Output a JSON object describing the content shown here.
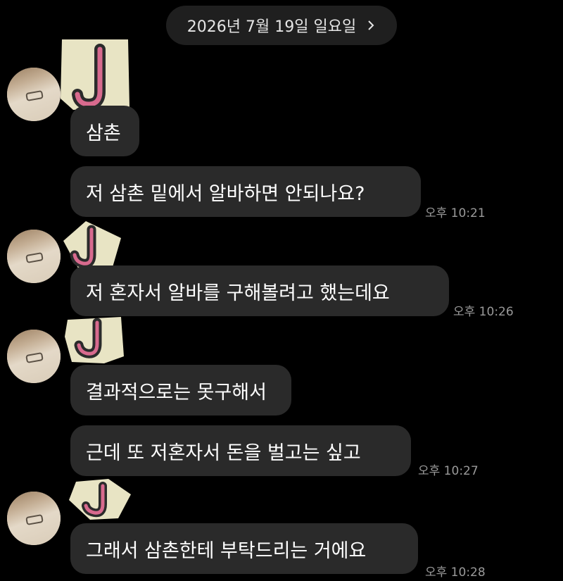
{
  "header": {
    "date_label": "2026년 7월 19일 일요일"
  },
  "messages": [
    {
      "text": "삼촌",
      "time": ""
    },
    {
      "text": "저 삼촌 밑에서 알바하면 안되나요?",
      "time": "오후 10:21"
    },
    {
      "text": "저 혼자서 알바를 구해볼려고 했는데요",
      "time": "오후 10:26"
    },
    {
      "text": "결과적으로는 못구해서",
      "time": ""
    },
    {
      "text": "근데 또 저혼자서 돈을 벌고는 싶고",
      "time": "오후 10:27"
    },
    {
      "text": "그래서 삼촌한테 부탁드리는 거에요",
      "time": "오후 10:28"
    }
  ],
  "sender": {
    "avatar_icon": "sender-avatar-photo",
    "sticker_icon": "letter-j-sticker-icon",
    "sticker_letter": "J"
  },
  "colors": {
    "background": "#000000",
    "bubble": "#2a2a2a",
    "timestamp": "#9a9a9a",
    "sticker_paper": "#e8e4c4",
    "sticker_letter": "#2b2b2b",
    "sticker_letter_inner": "#d86a8e"
  }
}
